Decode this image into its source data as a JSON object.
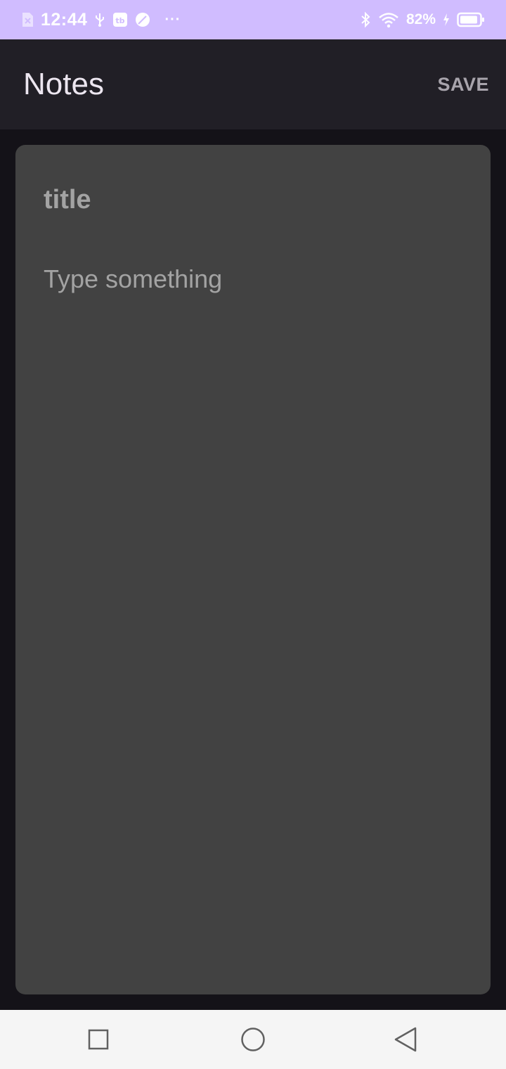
{
  "status_bar": {
    "time": "12:44",
    "ellipsis": "···",
    "battery_percent": "82%",
    "background_color": "#D0BCFF",
    "icons": [
      "sim-off-icon",
      "usb-icon",
      "notification-app-icon",
      "leaf-icon",
      "bluetooth-icon",
      "wifi-icon",
      "charging-bolt-icon",
      "battery-icon"
    ]
  },
  "app_bar": {
    "title": "Notes",
    "save_label": "SAVE"
  },
  "note": {
    "title_placeholder": "title",
    "title_value": "",
    "body_placeholder": "Type something",
    "body_value": "",
    "card_color": "#424242"
  },
  "nav_bar": {
    "icons": [
      "recents-icon",
      "home-icon",
      "back-icon"
    ]
  }
}
